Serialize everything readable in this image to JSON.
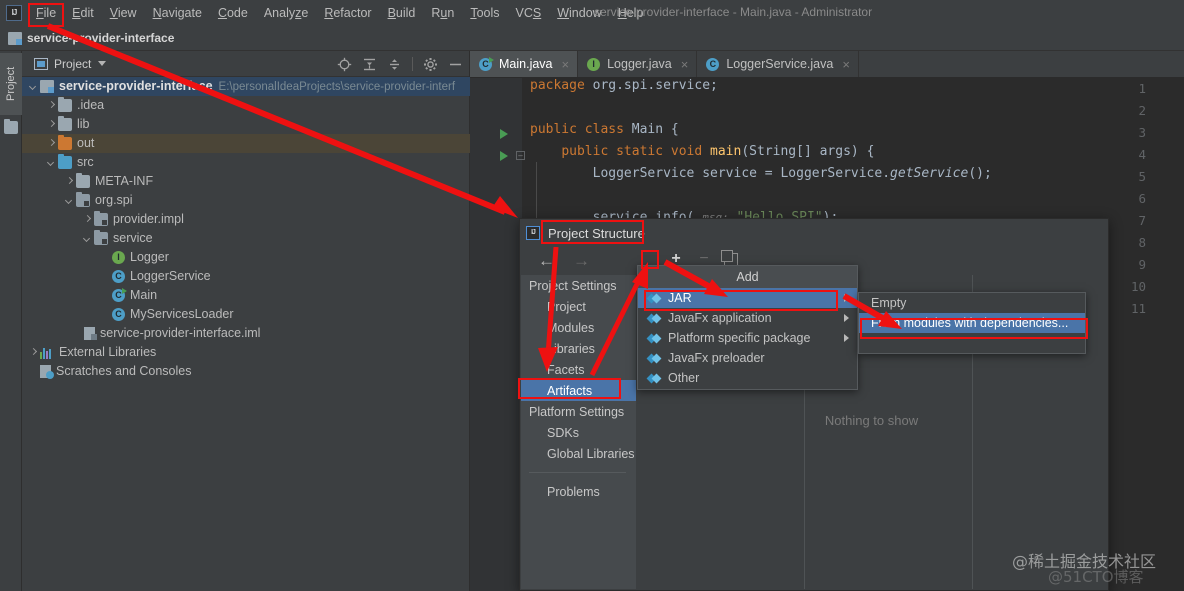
{
  "window": {
    "title": "service-provider-interface - Main.java - Administrator",
    "logo_text": "IJ"
  },
  "menubar": {
    "items": [
      {
        "label": "File",
        "mnemonic": "F"
      },
      {
        "label": "Edit",
        "mnemonic": "E"
      },
      {
        "label": "View",
        "mnemonic": "V"
      },
      {
        "label": "Navigate",
        "mnemonic": "N"
      },
      {
        "label": "Code",
        "mnemonic": "C"
      },
      {
        "label": "Analyze",
        "mnemonic": "z"
      },
      {
        "label": "Refactor",
        "mnemonic": "R"
      },
      {
        "label": "Build",
        "mnemonic": "B"
      },
      {
        "label": "Run",
        "mnemonic": "u"
      },
      {
        "label": "Tools",
        "mnemonic": "T"
      },
      {
        "label": "VCS",
        "mnemonic": "S"
      },
      {
        "label": "Window",
        "mnemonic": "W"
      },
      {
        "label": "Help",
        "mnemonic": "H"
      }
    ]
  },
  "navbar": {
    "project_name": "service-provider-interface"
  },
  "toolstrip": {
    "project_tab": "Project"
  },
  "project_panel": {
    "title": "Project",
    "icons": [
      "locate-icon",
      "expand-all-icon",
      "collapse-all-icon",
      "gear-icon",
      "minimize-icon"
    ],
    "tree": [
      {
        "label": "service-provider-interface",
        "path": "E:\\personalIdeaProjects\\service-provider-interf",
        "indent": 0,
        "arrow": "open",
        "icon": "module-icon",
        "state": "selected",
        "bold": true
      },
      {
        "label": ".idea",
        "indent": 1,
        "arrow": "closed",
        "icon": "folder-icon"
      },
      {
        "label": "lib",
        "indent": 1,
        "arrow": "closed",
        "icon": "folder-icon"
      },
      {
        "label": "out",
        "indent": 1,
        "arrow": "closed",
        "icon": "folder-orange-icon",
        "state": "highlighted"
      },
      {
        "label": "src",
        "indent": 1,
        "arrow": "open",
        "icon": "folder-blue-icon"
      },
      {
        "label": "META-INF",
        "indent": 2,
        "arrow": "closed",
        "icon": "folder-icon"
      },
      {
        "label": "org.spi",
        "indent": 2,
        "arrow": "open",
        "icon": "package-icon"
      },
      {
        "label": "provider.impl",
        "indent": 3,
        "arrow": "closed",
        "icon": "package-icon"
      },
      {
        "label": "service",
        "indent": 3,
        "arrow": "open",
        "icon": "package-icon"
      },
      {
        "label": "Logger",
        "indent": 4,
        "arrow": "none",
        "icon": "interface-icon"
      },
      {
        "label": "LoggerService",
        "indent": 4,
        "arrow": "none",
        "icon": "class-icon"
      },
      {
        "label": "Main",
        "indent": 4,
        "arrow": "none",
        "icon": "runnable-class-icon"
      },
      {
        "label": "MyServicesLoader",
        "indent": 4,
        "arrow": "none",
        "icon": "class-icon"
      },
      {
        "label": "service-provider-interface.iml",
        "indent": 2,
        "arrow": "none",
        "icon": "iml-icon"
      },
      {
        "label": "External Libraries",
        "indent": 0,
        "arrow": "closed",
        "icon": "library-icon"
      },
      {
        "label": "Scratches and Consoles",
        "indent": 0,
        "arrow": "none",
        "icon": "scratches-icon"
      }
    ]
  },
  "editor": {
    "tabs": [
      {
        "label": "Main.java",
        "icon": "class-icon",
        "active": true
      },
      {
        "label": "Logger.java",
        "icon": "interface-icon",
        "active": false
      },
      {
        "label": "LoggerService.java",
        "icon": "class-icon",
        "active": false
      }
    ],
    "close_glyph": "×",
    "line_numbers": [
      "1",
      "2",
      "3",
      "4",
      "5",
      "6",
      "7",
      "8",
      "9",
      "10",
      "11"
    ],
    "lines": [
      {
        "n": 1,
        "text": "package org.spi.service;"
      },
      {
        "n": 2,
        "text": ""
      },
      {
        "n": 3,
        "text": "public class Main {"
      },
      {
        "n": 4,
        "text": "    public static void main(String[] args) {"
      },
      {
        "n": 5,
        "text": "        LoggerService service = LoggerService.getService();"
      },
      {
        "n": 6,
        "text": ""
      },
      {
        "n": 7,
        "text": "        service.info( msg: \"Hello SPI\");"
      }
    ],
    "param_hint": "msg:",
    "string_literal": "\"Hello SPI\""
  },
  "dialog": {
    "title": "Project Structure",
    "logo_text": "IJ",
    "toolbar": {
      "back": "←",
      "forward": "→",
      "add": "+",
      "remove": "−",
      "copy": "copy-icon"
    },
    "sidebar": [
      {
        "label": "Project Settings",
        "type": "group"
      },
      {
        "label": "Project",
        "type": "child"
      },
      {
        "label": "Modules",
        "type": "child"
      },
      {
        "label": "Libraries",
        "type": "child"
      },
      {
        "label": "Facets",
        "type": "child"
      },
      {
        "label": "Artifacts",
        "type": "child",
        "selected": true
      },
      {
        "label": "Platform Settings",
        "type": "group"
      },
      {
        "label": "SDKs",
        "type": "child"
      },
      {
        "label": "Global Libraries",
        "type": "child"
      },
      {
        "label": "__divider__",
        "type": "divider"
      },
      {
        "label": "Problems",
        "type": "child"
      }
    ],
    "empty_message": "Nothing to show"
  },
  "add_popup": {
    "title": "Add",
    "items": [
      {
        "label": "JAR",
        "selected": true,
        "submenu": true
      },
      {
        "label": "JavaFx application",
        "selected": false,
        "submenu": true
      },
      {
        "label": "Platform specific package",
        "selected": false,
        "submenu": true
      },
      {
        "label": "JavaFx preloader",
        "selected": false,
        "submenu": false
      },
      {
        "label": "Other",
        "selected": false,
        "submenu": false
      }
    ]
  },
  "jar_submenu": {
    "items": [
      {
        "label": "Empty",
        "selected": false
      },
      {
        "label": "From modules with dependencies...",
        "selected": true
      }
    ]
  },
  "watermarks": {
    "primary": "@稀土掘金技术社区",
    "secondary": "@51CTO博客"
  },
  "annotation": {
    "color": "#ee1111",
    "boxes": [
      "file-menu",
      "project-structure-title",
      "plus-button",
      "artifacts-item",
      "jar-item",
      "from-modules-item"
    ]
  }
}
